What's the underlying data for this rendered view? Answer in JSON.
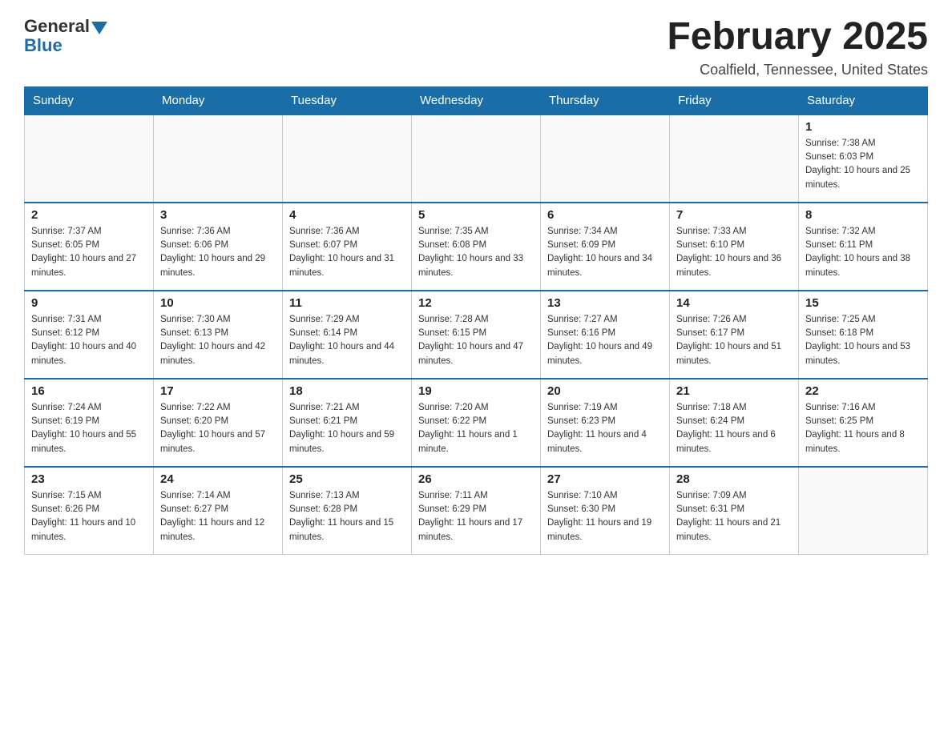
{
  "header": {
    "logo_general": "General",
    "logo_blue": "Blue",
    "month_title": "February 2025",
    "location": "Coalfield, Tennessee, United States"
  },
  "days_of_week": [
    "Sunday",
    "Monday",
    "Tuesday",
    "Wednesday",
    "Thursday",
    "Friday",
    "Saturday"
  ],
  "weeks": [
    [
      {
        "day": "",
        "sunrise": "",
        "sunset": "",
        "daylight": ""
      },
      {
        "day": "",
        "sunrise": "",
        "sunset": "",
        "daylight": ""
      },
      {
        "day": "",
        "sunrise": "",
        "sunset": "",
        "daylight": ""
      },
      {
        "day": "",
        "sunrise": "",
        "sunset": "",
        "daylight": ""
      },
      {
        "day": "",
        "sunrise": "",
        "sunset": "",
        "daylight": ""
      },
      {
        "day": "",
        "sunrise": "",
        "sunset": "",
        "daylight": ""
      },
      {
        "day": "1",
        "sunrise": "Sunrise: 7:38 AM",
        "sunset": "Sunset: 6:03 PM",
        "daylight": "Daylight: 10 hours and 25 minutes."
      }
    ],
    [
      {
        "day": "2",
        "sunrise": "Sunrise: 7:37 AM",
        "sunset": "Sunset: 6:05 PM",
        "daylight": "Daylight: 10 hours and 27 minutes."
      },
      {
        "day": "3",
        "sunrise": "Sunrise: 7:36 AM",
        "sunset": "Sunset: 6:06 PM",
        "daylight": "Daylight: 10 hours and 29 minutes."
      },
      {
        "day": "4",
        "sunrise": "Sunrise: 7:36 AM",
        "sunset": "Sunset: 6:07 PM",
        "daylight": "Daylight: 10 hours and 31 minutes."
      },
      {
        "day": "5",
        "sunrise": "Sunrise: 7:35 AM",
        "sunset": "Sunset: 6:08 PM",
        "daylight": "Daylight: 10 hours and 33 minutes."
      },
      {
        "day": "6",
        "sunrise": "Sunrise: 7:34 AM",
        "sunset": "Sunset: 6:09 PM",
        "daylight": "Daylight: 10 hours and 34 minutes."
      },
      {
        "day": "7",
        "sunrise": "Sunrise: 7:33 AM",
        "sunset": "Sunset: 6:10 PM",
        "daylight": "Daylight: 10 hours and 36 minutes."
      },
      {
        "day": "8",
        "sunrise": "Sunrise: 7:32 AM",
        "sunset": "Sunset: 6:11 PM",
        "daylight": "Daylight: 10 hours and 38 minutes."
      }
    ],
    [
      {
        "day": "9",
        "sunrise": "Sunrise: 7:31 AM",
        "sunset": "Sunset: 6:12 PM",
        "daylight": "Daylight: 10 hours and 40 minutes."
      },
      {
        "day": "10",
        "sunrise": "Sunrise: 7:30 AM",
        "sunset": "Sunset: 6:13 PM",
        "daylight": "Daylight: 10 hours and 42 minutes."
      },
      {
        "day": "11",
        "sunrise": "Sunrise: 7:29 AM",
        "sunset": "Sunset: 6:14 PM",
        "daylight": "Daylight: 10 hours and 44 minutes."
      },
      {
        "day": "12",
        "sunrise": "Sunrise: 7:28 AM",
        "sunset": "Sunset: 6:15 PM",
        "daylight": "Daylight: 10 hours and 47 minutes."
      },
      {
        "day": "13",
        "sunrise": "Sunrise: 7:27 AM",
        "sunset": "Sunset: 6:16 PM",
        "daylight": "Daylight: 10 hours and 49 minutes."
      },
      {
        "day": "14",
        "sunrise": "Sunrise: 7:26 AM",
        "sunset": "Sunset: 6:17 PM",
        "daylight": "Daylight: 10 hours and 51 minutes."
      },
      {
        "day": "15",
        "sunrise": "Sunrise: 7:25 AM",
        "sunset": "Sunset: 6:18 PM",
        "daylight": "Daylight: 10 hours and 53 minutes."
      }
    ],
    [
      {
        "day": "16",
        "sunrise": "Sunrise: 7:24 AM",
        "sunset": "Sunset: 6:19 PM",
        "daylight": "Daylight: 10 hours and 55 minutes."
      },
      {
        "day": "17",
        "sunrise": "Sunrise: 7:22 AM",
        "sunset": "Sunset: 6:20 PM",
        "daylight": "Daylight: 10 hours and 57 minutes."
      },
      {
        "day": "18",
        "sunrise": "Sunrise: 7:21 AM",
        "sunset": "Sunset: 6:21 PM",
        "daylight": "Daylight: 10 hours and 59 minutes."
      },
      {
        "day": "19",
        "sunrise": "Sunrise: 7:20 AM",
        "sunset": "Sunset: 6:22 PM",
        "daylight": "Daylight: 11 hours and 1 minute."
      },
      {
        "day": "20",
        "sunrise": "Sunrise: 7:19 AM",
        "sunset": "Sunset: 6:23 PM",
        "daylight": "Daylight: 11 hours and 4 minutes."
      },
      {
        "day": "21",
        "sunrise": "Sunrise: 7:18 AM",
        "sunset": "Sunset: 6:24 PM",
        "daylight": "Daylight: 11 hours and 6 minutes."
      },
      {
        "day": "22",
        "sunrise": "Sunrise: 7:16 AM",
        "sunset": "Sunset: 6:25 PM",
        "daylight": "Daylight: 11 hours and 8 minutes."
      }
    ],
    [
      {
        "day": "23",
        "sunrise": "Sunrise: 7:15 AM",
        "sunset": "Sunset: 6:26 PM",
        "daylight": "Daylight: 11 hours and 10 minutes."
      },
      {
        "day": "24",
        "sunrise": "Sunrise: 7:14 AM",
        "sunset": "Sunset: 6:27 PM",
        "daylight": "Daylight: 11 hours and 12 minutes."
      },
      {
        "day": "25",
        "sunrise": "Sunrise: 7:13 AM",
        "sunset": "Sunset: 6:28 PM",
        "daylight": "Daylight: 11 hours and 15 minutes."
      },
      {
        "day": "26",
        "sunrise": "Sunrise: 7:11 AM",
        "sunset": "Sunset: 6:29 PM",
        "daylight": "Daylight: 11 hours and 17 minutes."
      },
      {
        "day": "27",
        "sunrise": "Sunrise: 7:10 AM",
        "sunset": "Sunset: 6:30 PM",
        "daylight": "Daylight: 11 hours and 19 minutes."
      },
      {
        "day": "28",
        "sunrise": "Sunrise: 7:09 AM",
        "sunset": "Sunset: 6:31 PM",
        "daylight": "Daylight: 11 hours and 21 minutes."
      },
      {
        "day": "",
        "sunrise": "",
        "sunset": "",
        "daylight": ""
      }
    ]
  ]
}
